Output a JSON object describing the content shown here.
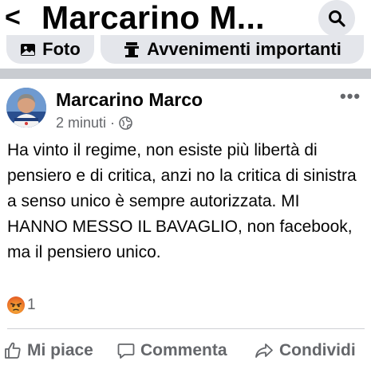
{
  "header": {
    "back_glyph": "<",
    "title": "Marcarino M...",
    "search_icon": "search-icon"
  },
  "chips": {
    "foto_label": "Foto",
    "events_label": "Avvenimenti importanti"
  },
  "post": {
    "author": "Marcarino Marco",
    "time": "2 minuti",
    "separator": "·",
    "audience_icon": "globe-icon",
    "more_glyph": "•••",
    "text": "Ha vinto il regime, non esiste più libertà di pensiero e di critica, anzi no la critica di sinistra a senso unico è sempre autorizzata. MI HANNO MESSO IL BAVAGLIO, non facebook, ma il pensiero unico.",
    "reaction_icon": "angry-reaction-icon",
    "reaction_count": "1"
  },
  "actions": {
    "like_label": "Mi piace",
    "comment_label": "Commenta",
    "share_label": "Condividi"
  },
  "colors": {
    "text": "#050505",
    "secondary": "#65676b",
    "chip_bg": "#e4e6eb",
    "separator_band": "#c9ccd1"
  }
}
